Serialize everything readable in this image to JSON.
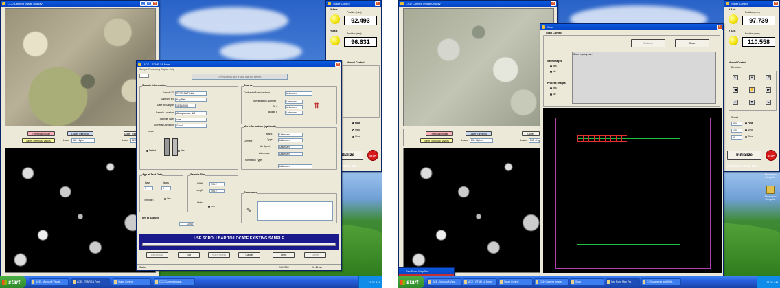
{
  "left": {
    "camera_window": {
      "title": "CCD Camera Image Display"
    },
    "threshold": {
      "threshold_image": "Threshold Image",
      "save_threshold": "Save Threshold Values",
      "lower_threshold": "Lower Threshold",
      "lower_label": "Lower",
      "lower_value": "80 - Higher",
      "upper_threshold": "Upper Threshold",
      "upper_label": "Lower",
      "upper_value": "225"
    },
    "form": {
      "title": "ACE - RTNR 1A Form",
      "menu": "Sample  Processing  Display  Help",
      "banner": "<Please Enter Your Name Here>",
      "sample_info_title": "Sample Information",
      "sample_id_label": "Sample ID",
      "sample_id_value": "RTNR-1A Fields",
      "sampled_by_label": "Sampled By",
      "sampled_by_value": "Kay Ratt",
      "date_label": "Date of Sample",
      "date_value": "11/11/2005",
      "location_label": "Sample Location",
      "location_value": "Albuquerque, NM",
      "type_label": "Sample Type",
      "type_value": "core",
      "condition_label": "General Condition",
      "condition_value": "Good",
      "cores_label": "cores",
      "defect_label": "Defect",
      "yes_label": "Yes",
      "source_title": "Source",
      "contractor_label": "Contractor/Manufacturer",
      "contractor_value": "Unknown",
      "inv_label": "Investigation Number",
      "inv_value": "Unknown",
      "st_label": "St. #",
      "st_value": "Unknown",
      "bridge_label": "Bridge #",
      "bridge_value": "Unknown",
      "mix_title": "Mix Information (optional)",
      "cement_label": "Cement",
      "brand_label": "Brand",
      "brand_value": "Unknown",
      "mix_type_label": "Type",
      "mix_type_value": "Unknown",
      "air_label": "Air Agent",
      "air_value": "Unknown",
      "admix_label": "Admixture",
      "admix_value": "Unknown",
      "finish_label": "Formation Type",
      "finish_value": "Unknown",
      "age_title": "Age at Test Date",
      "days_label": "Days",
      "days_value": "0",
      "years_label": "Years",
      "years_value": "0",
      "estimate_label": "Estimate?",
      "size_title": "Sample Size",
      "width_label": "Width",
      "width_value": "203.2",
      "length_label": "Length",
      "length_value": "203.2",
      "units_label": "Units",
      "units_value": "mm",
      "analyze_label": "nes to Analyze",
      "analyze_value": "2500",
      "comments_title": "Comments",
      "scroll_banner": "USE SCROLLBAR TO LOCATE EXISTING SAMPLE",
      "buttons": [
        "Add/Update",
        "Edit",
        "Run Process",
        "Cancel",
        "Open",
        "Delete"
      ],
      "status_left": "Status",
      "status_date": "1/6/2006",
      "status_time": "11:21 am"
    },
    "stage": {
      "title": "Stage Control",
      "x_axis": "X Axis",
      "x_pos_label": "Position (mm)",
      "x_pos": "92.493",
      "y_axis": "Y Axis",
      "y_pos_label": "Position (mm)",
      "y_pos": "96.631",
      "manual": "Manual Control",
      "speed_fast": "Fast",
      "speed_med": "Med",
      "speed_slow": "Slow",
      "speed_fast_val": "500",
      "speed_med_val": "100",
      "speed_slow_val": "10",
      "initialize": "Initialize",
      "stop": "STOP",
      "init_status": "ialization Done OK"
    },
    "taskbar": {
      "start": "start",
      "tasks": [
        "ACE - Microsoft Visual...",
        "ACE - RTNR 1A Form",
        "Stage Control",
        "CCD Camera Image..."
      ],
      "clock": "11:21 AM"
    }
  },
  "right": {
    "camera_window": {
      "title": "CCD Camera Image Display"
    },
    "threshold": {
      "threshold_image": "Threshold Image",
      "save_threshold": "Save Threshold Values",
      "lower_threshold": "Lower Threshold",
      "lower_label": "Lower",
      "lower_value": "80 - Higher",
      "upper_threshold": "Upper",
      "upper_label": "Lower",
      "upper_value": "215 - High"
    },
    "scan": {
      "title": "Scan",
      "control_title": "Scan Control",
      "continue_btn": "Continue",
      "close_btn": "Close",
      "save_images": "Save Images",
      "process_images": "Process Images",
      "yes": "Yes",
      "no": "No",
      "log_text": "Scan in progress..."
    },
    "stage": {
      "title": "Stage Control",
      "x_axis": "X Axis",
      "x_pos_label": "Position (mm)",
      "x_pos": "97.739",
      "y_axis": "Y Axis",
      "y_pos_label": "Position (mm)",
      "y_pos": "110.558",
      "manual": "Manual Control",
      "direction": "Direction",
      "speed_label": "Speed",
      "speed_fast": "Fast",
      "speed_med": "Med",
      "speed_slow": "Slow",
      "speed_fast_val": "500",
      "speed_med_val": "100",
      "speed_slow_val": "10",
      "initialize": "Initialize",
      "stop": "STOP",
      "init_status": "itialization Done OK"
    },
    "desktop_icons": [
      {
        "label": "Shortcut to Computer"
      },
      {
        "label": "Shortcut to Computer"
      }
    ],
    "plot_window": {
      "title": "Sec Point Map Pro"
    },
    "taskbar": {
      "start": "start",
      "tasks": [
        "ACE - Microsoft Visu...",
        "ACE - RTNR 1A Form",
        "Stage Control",
        "CCD Camera Image...",
        "Scan",
        "Sec Point Map Pro",
        "C:\\Documents and Sett..."
      ],
      "clock": "11:21 AM"
    }
  }
}
